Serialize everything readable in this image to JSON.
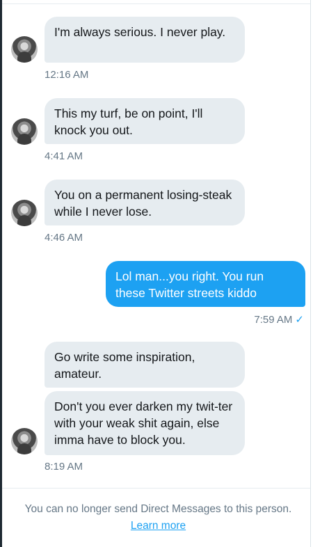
{
  "conversation": {
    "messages": [
      {
        "direction": "in",
        "text": "I'm always serious.  I never play.",
        "time": "12:16 AM"
      },
      {
        "direction": "in",
        "text": "This my turf, be on point, I'll knock you out.",
        "time": "4:41 AM"
      },
      {
        "direction": "in",
        "text": "You on a permanent losing-steak while I never lose.",
        "time": "4:46 AM"
      },
      {
        "direction": "out",
        "text": "Lol man...you right. You run these Twitter streets kiddo",
        "time": "7:59 AM",
        "status_icon": "check-icon"
      },
      {
        "direction": "in",
        "text": "Go write some inspiration, amateur."
      },
      {
        "direction": "in",
        "text": "Don't you ever darken my twit-ter with your weak shit again, else imma have to block you.",
        "time": "8:19 AM"
      }
    ]
  },
  "footer": {
    "notice": "You can no longer send Direct Messages to this person.",
    "link": "Learn more"
  },
  "colors": {
    "incoming_bubble": "#e6ecf0",
    "outgoing_bubble": "#1da1f2",
    "timestamp": "#657786",
    "link": "#1da1f2"
  }
}
